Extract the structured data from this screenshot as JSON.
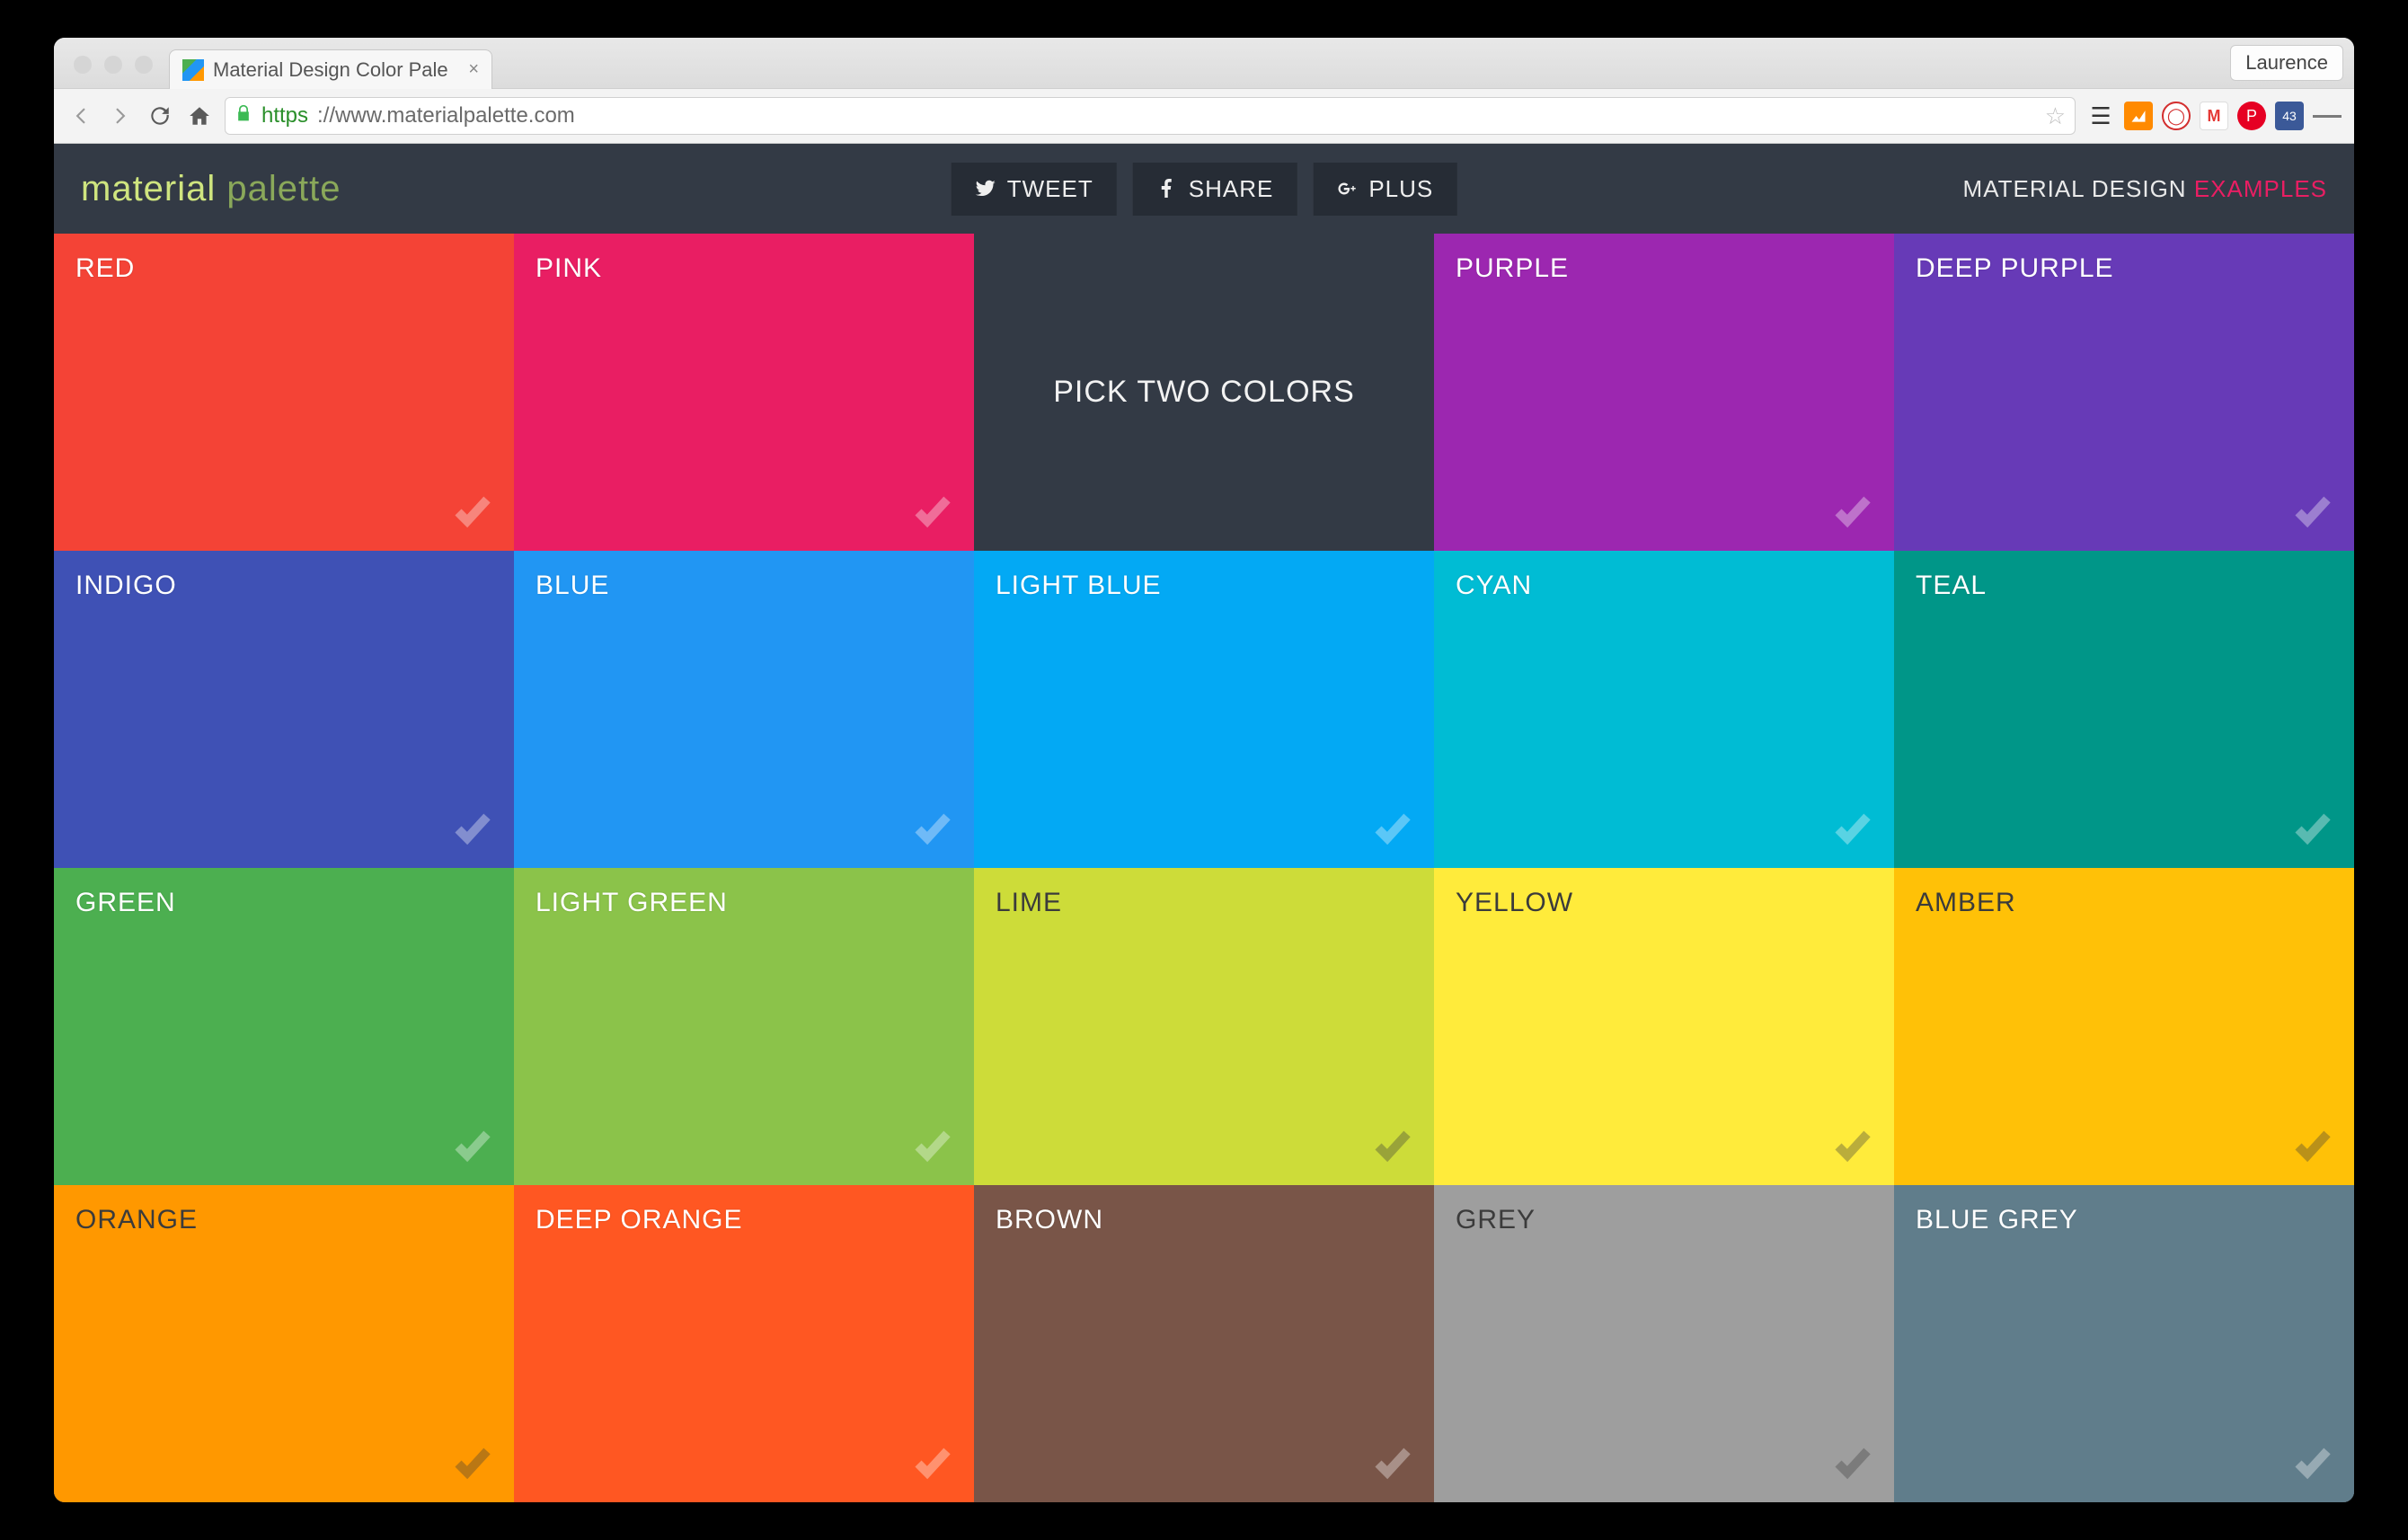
{
  "browser": {
    "tab_title": "Material Design Color Pale",
    "profile_name": "Laurence",
    "url_scheme": "https",
    "url_rest": "://www.materialpalette.com",
    "extensions_calendar_badge": "43"
  },
  "header": {
    "logo_word1": "material",
    "logo_word2": "palette",
    "tweet": "TWEET",
    "share": "SHARE",
    "plus": "PLUS",
    "link_design": "MATERIAL DESIGN",
    "link_examples": "EXAMPLES"
  },
  "pick_two_label": "PICK TWO COLORS",
  "swatches": [
    {
      "name": "RED",
      "hex": "#f44336",
      "dark": false
    },
    {
      "name": "PINK",
      "hex": "#e91e63",
      "dark": false
    },
    {
      "name": "__PICK__",
      "hex": "",
      "dark": false
    },
    {
      "name": "PURPLE",
      "hex": "#9c27b0",
      "dark": false
    },
    {
      "name": "DEEP PURPLE",
      "hex": "#673ab7",
      "dark": false
    },
    {
      "name": "INDIGO",
      "hex": "#3f51b5",
      "dark": false
    },
    {
      "name": "BLUE",
      "hex": "#2196f3",
      "dark": false
    },
    {
      "name": "LIGHT BLUE",
      "hex": "#03a9f4",
      "dark": false
    },
    {
      "name": "CYAN",
      "hex": "#00bcd4",
      "dark": false
    },
    {
      "name": "TEAL",
      "hex": "#009688",
      "dark": false
    },
    {
      "name": "GREEN",
      "hex": "#4caf50",
      "dark": false
    },
    {
      "name": "LIGHT GREEN",
      "hex": "#8bc34a",
      "dark": false
    },
    {
      "name": "LIME",
      "hex": "#cddc39",
      "dark": true
    },
    {
      "name": "YELLOW",
      "hex": "#ffeb3b",
      "dark": true
    },
    {
      "name": "AMBER",
      "hex": "#ffc107",
      "dark": true
    },
    {
      "name": "ORANGE",
      "hex": "#ff9800",
      "dark": true
    },
    {
      "name": "DEEP ORANGE",
      "hex": "#ff5722",
      "dark": false
    },
    {
      "name": "BROWN",
      "hex": "#795548",
      "dark": false
    },
    {
      "name": "GREY",
      "hex": "#9e9e9e",
      "dark": true
    },
    {
      "name": "BLUE GREY",
      "hex": "#607d8b",
      "dark": false
    }
  ]
}
